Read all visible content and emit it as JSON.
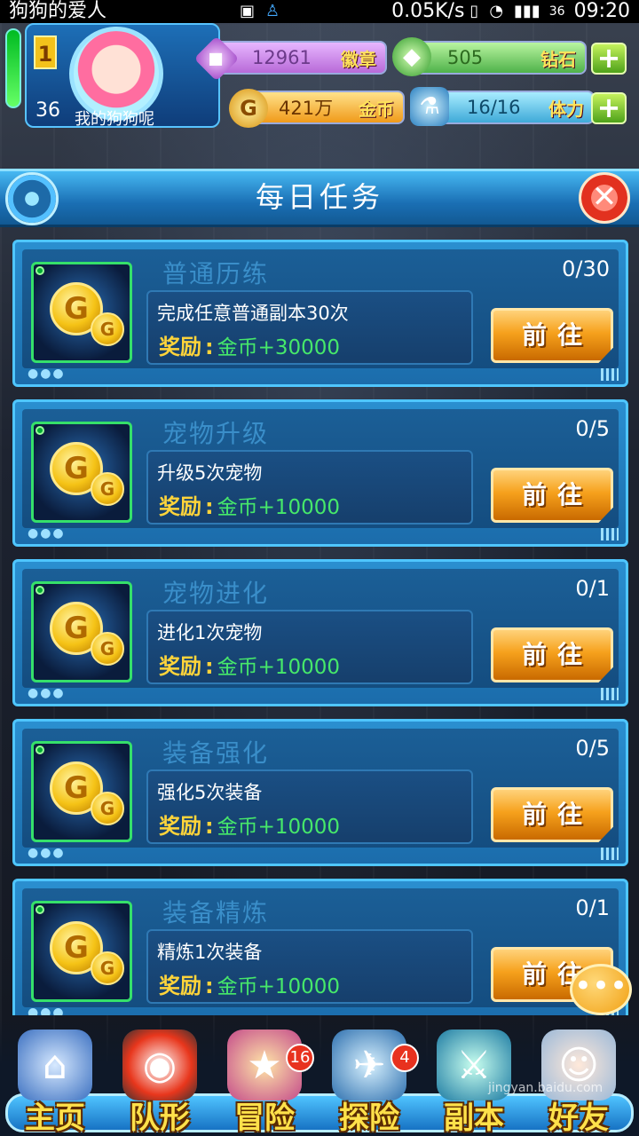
{
  "status_bar": {
    "app_title": "狗狗的爱人",
    "speed": "0.05K/s",
    "signal_label": "36",
    "time": "09:20"
  },
  "hud": {
    "level": "1",
    "hp": "36",
    "player_name": "我的狗狗呢",
    "resources": {
      "badge": {
        "value": "12961",
        "label": "徽章"
      },
      "diamond": {
        "value": "505",
        "label": "钻石"
      },
      "gold": {
        "value": "421万",
        "label": "金币"
      },
      "stamina": {
        "value": "16/16",
        "label": "体力"
      }
    },
    "plus_symbol": "+"
  },
  "panel": {
    "title": "每日任务",
    "close_symbol": "✕"
  },
  "tasks": [
    {
      "name": "普通历练",
      "progress": "0/30",
      "desc": "完成任意普通副本30次",
      "reward_label": "奖励",
      "reward_value": "金币+30000",
      "button": "前往"
    },
    {
      "name": "宠物升级",
      "progress": "0/5",
      "desc": "升级5次宠物",
      "reward_label": "奖励",
      "reward_value": "金币+10000",
      "button": "前往"
    },
    {
      "name": "宠物进化",
      "progress": "0/1",
      "desc": "进化1次宠物",
      "reward_label": "奖励",
      "reward_value": "金币+10000",
      "button": "前往"
    },
    {
      "name": "装备强化",
      "progress": "0/5",
      "desc": "强化5次装备",
      "reward_label": "奖励",
      "reward_value": "金币+10000",
      "button": "前往"
    },
    {
      "name": "装备精炼",
      "progress": "0/1",
      "desc": "精炼1次装备",
      "reward_label": "奖励",
      "reward_value": "金币+10000",
      "button": "前往"
    }
  ],
  "coin_letter": "G",
  "chat_symbol": "•••",
  "nav": [
    {
      "label": "主页",
      "icon": "robot-home-icon",
      "badge": ""
    },
    {
      "label": "队形",
      "icon": "pokeball-robot-icon",
      "badge": ""
    },
    {
      "label": "冒险",
      "icon": "star-ship-icon",
      "badge": "16"
    },
    {
      "label": "探险",
      "icon": "mech-ship-icon",
      "badge": "4"
    },
    {
      "label": "副本",
      "icon": "mech-warrior-icon",
      "badge": ""
    },
    {
      "label": "好友",
      "icon": "friends-avatar-icon",
      "badge": ""
    }
  ],
  "watermark": "jingyan.baidu.com"
}
